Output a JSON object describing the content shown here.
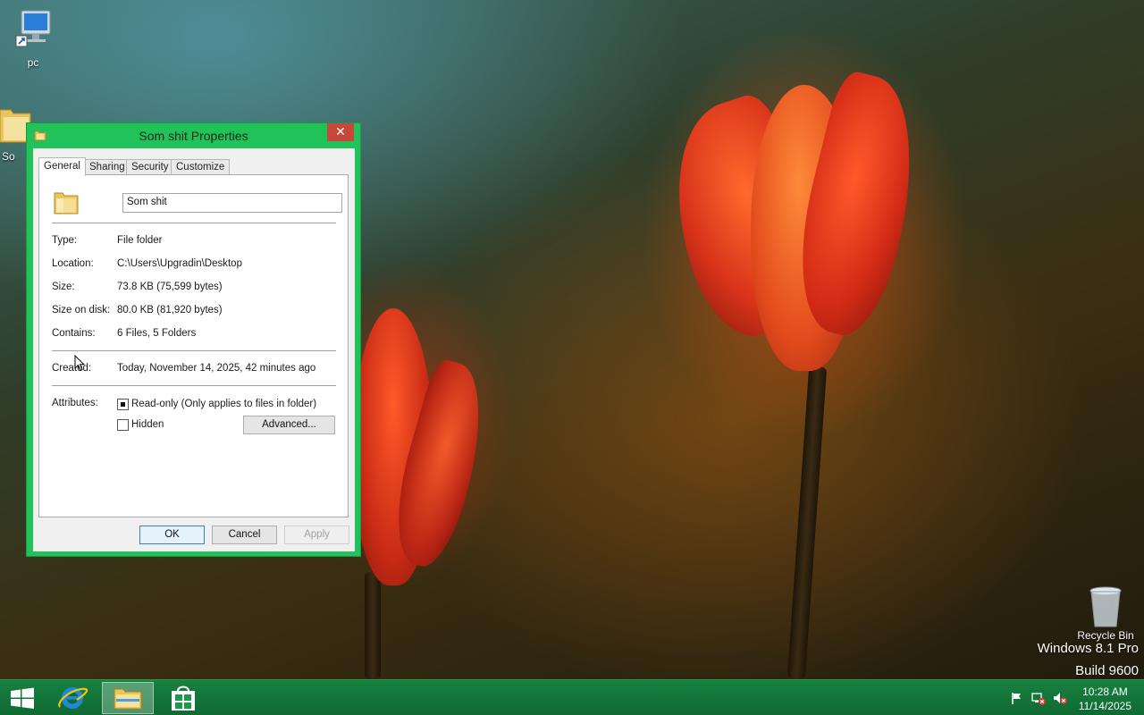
{
  "desktop": {
    "icons": [
      {
        "label": "pc"
      },
      {
        "label": "So"
      },
      {
        "label": "Recycle Bin"
      }
    ],
    "watermark": {
      "line1": "Windows 8.1 Pro",
      "line2": "Build 9600"
    }
  },
  "dialog": {
    "title": "Som shit Properties",
    "close_glyph": "✕",
    "tabs": [
      {
        "label": "General",
        "active": true
      },
      {
        "label": "Sharing"
      },
      {
        "label": "Security"
      },
      {
        "label": "Customize"
      }
    ],
    "name_value": "Som shit",
    "properties": [
      {
        "label": "Type:",
        "value": "File folder"
      },
      {
        "label": "Location:",
        "value": "C:\\Users\\Upgradin\\Desktop"
      },
      {
        "label": "Size:",
        "value": "73.8 KB (75,599 bytes)"
      },
      {
        "label": "Size on disk:",
        "value": "80.0 KB (81,920 bytes)"
      },
      {
        "label": "Contains:",
        "value": "6 Files, 5 Folders"
      }
    ],
    "created": {
      "label": "Created:",
      "value": "Today, November 14, 2025, 42 minutes ago"
    },
    "attributes": {
      "label": "Attributes:",
      "readonly_label": "Read-only (Only applies to files in folder)",
      "readonly_state": "indeterminate",
      "hidden_label": "Hidden",
      "hidden_checked": false,
      "advanced_label": "Advanced..."
    },
    "buttons": {
      "ok": "OK",
      "cancel": "Cancel",
      "apply": "Apply"
    }
  },
  "taskbar": {
    "items": [
      {
        "icon": "windows-start-icon"
      },
      {
        "icon": "internet-explorer-icon"
      },
      {
        "icon": "file-explorer-icon",
        "active": true
      },
      {
        "icon": "store-icon"
      }
    ],
    "tray": [
      {
        "icon": "action-center-flag-icon"
      },
      {
        "icon": "network-error-icon"
      },
      {
        "icon": "volume-muted-icon"
      }
    ],
    "clock": {
      "time": "10:28 AM",
      "date": "11/14/2025"
    }
  },
  "colors": {
    "accent": "#22c25a",
    "taskbar": "#147a3b",
    "close": "#c7483b"
  }
}
